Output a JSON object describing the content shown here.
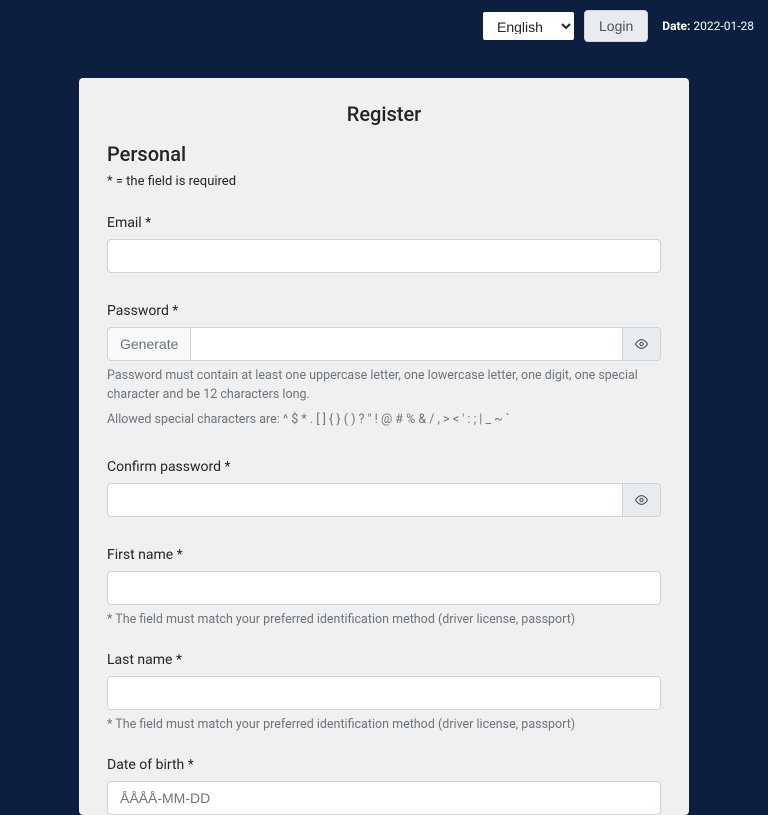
{
  "topbar": {
    "language_selected": "English",
    "login_label": "Login",
    "date_label": "Date:",
    "date_value": "2022-01-28"
  },
  "page": {
    "title": "Register",
    "section_title": "Personal",
    "required_note": "* = the field is required"
  },
  "form": {
    "email_label": "Email *",
    "password_label": "Password *",
    "generate_label": "Generate",
    "password_help1": "Password must contain at least one uppercase letter, one lowercase letter, one digit, one special character and be 12 characters long.",
    "password_help2": "Allowed special characters are: ^ $ * . [ ] { } ( ) ? \" ! @ # % & / , > < ' : ; | _ ~ `",
    "confirm_password_label": "Confirm password *",
    "first_name_label": "First name *",
    "first_name_help": "* The field must match your preferred identification method (driver license, passport)",
    "last_name_label": "Last name *",
    "last_name_help": "* The field must match your preferred identification method (driver license, passport)",
    "dob_label": "Date of birth *",
    "dob_placeholder": "ÅÅÅÅ-MM-DD"
  }
}
